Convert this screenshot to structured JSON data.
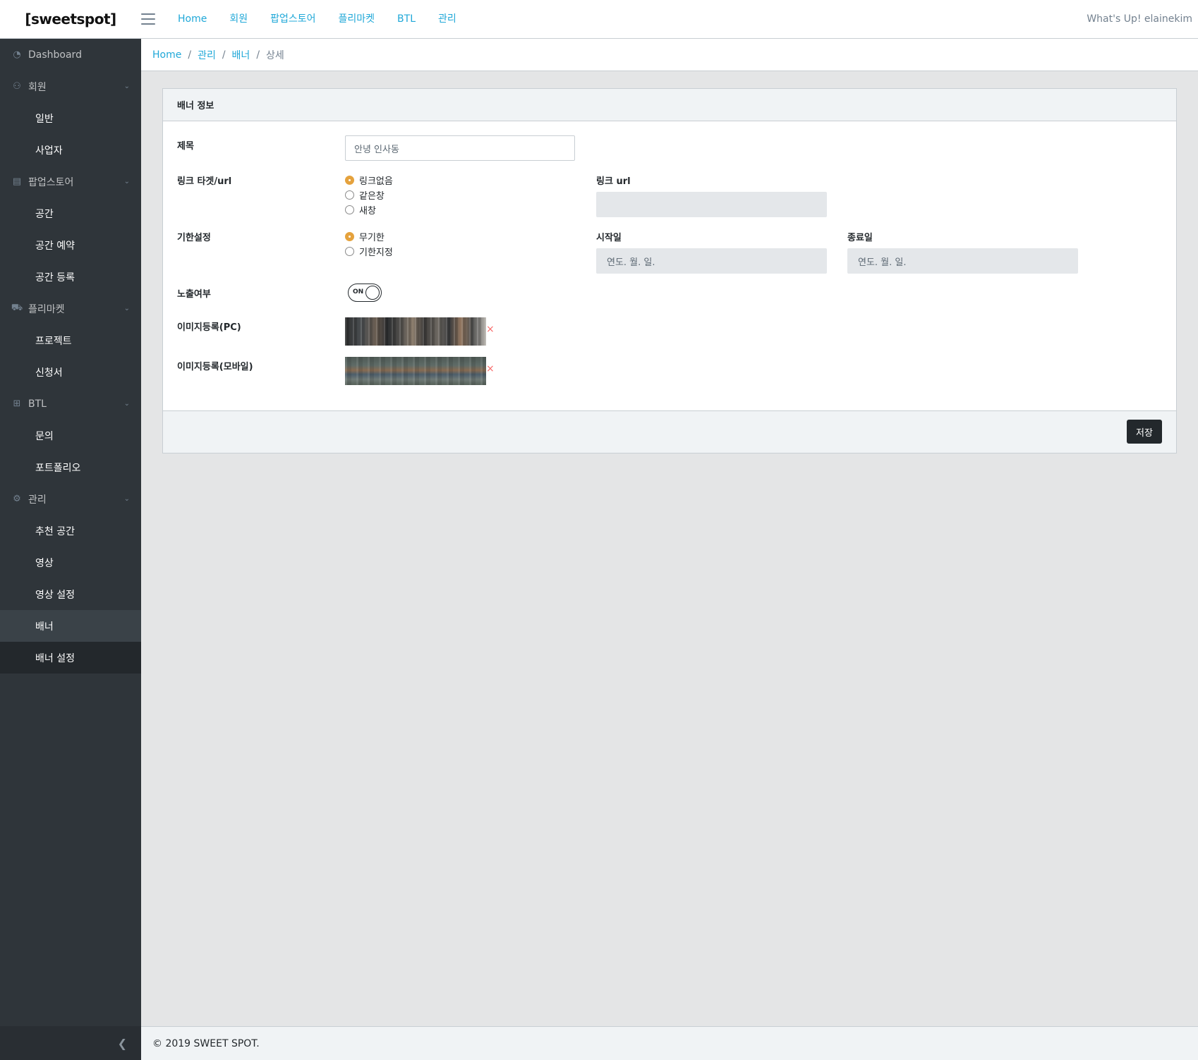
{
  "brand": {
    "logo_text": "[sweetspot]"
  },
  "topnav": [
    "Home",
    "회원",
    "팝업스토어",
    "플리마켓",
    "BTL",
    "관리"
  ],
  "header": {
    "greeting": "What's Up! elainekim"
  },
  "sidebar": {
    "items": [
      {
        "label": "Dashboard",
        "icon": "speedometer-icon"
      },
      {
        "label": "회원",
        "icon": "user-icon"
      },
      {
        "label": "일반"
      },
      {
        "label": "사업자"
      },
      {
        "label": "팝업스토어",
        "icon": "building-icon"
      },
      {
        "label": "공간"
      },
      {
        "label": "공간 예약"
      },
      {
        "label": "공간 등록"
      },
      {
        "label": "플리마켓",
        "icon": "cart-icon"
      },
      {
        "label": "프로젝트"
      },
      {
        "label": "신청서"
      },
      {
        "label": "BTL",
        "icon": "grid-icon"
      },
      {
        "label": "문의"
      },
      {
        "label": "포트폴리오"
      },
      {
        "label": "관리",
        "icon": "gear-icon"
      },
      {
        "label": "추천 공간"
      },
      {
        "label": "영상"
      },
      {
        "label": "영상 설정"
      },
      {
        "label": "배너"
      },
      {
        "label": "배너 설정"
      }
    ]
  },
  "breadcrumb": {
    "items": [
      "Home",
      "관리",
      "배너"
    ],
    "current": "상세"
  },
  "card": {
    "title": "배너 정보",
    "title_label": "제목",
    "title_value": "안녕 인사동",
    "link_label": "링크 타겟/url",
    "link_options": [
      "링크없음",
      "같은창",
      "새창"
    ],
    "link_selected": "링크없음",
    "link_url_label": "링크 url",
    "link_url_value": "",
    "period_label": "기한설정",
    "period_options": [
      "무기한",
      "기한지정"
    ],
    "period_selected": "무기한",
    "start_label": "시작일",
    "start_placeholder": "연도. 월. 일.",
    "end_label": "종료일",
    "end_placeholder": "연도. 월. 일.",
    "visible_label": "노출여부",
    "visible_toggle": "ON",
    "image_pc_label": "이미지등록(PC)",
    "image_mobile_label": "이미지등록(모바일)",
    "delete_mark": "×",
    "save_label": "저장"
  },
  "footer": {
    "copyright": "© 2019 SWEET SPOT."
  },
  "colors": {
    "accent": "#20a8d8",
    "sidebar_bg": "#2f353a",
    "radio_selected": "#e5a23d",
    "delete": "#f86c6b"
  }
}
